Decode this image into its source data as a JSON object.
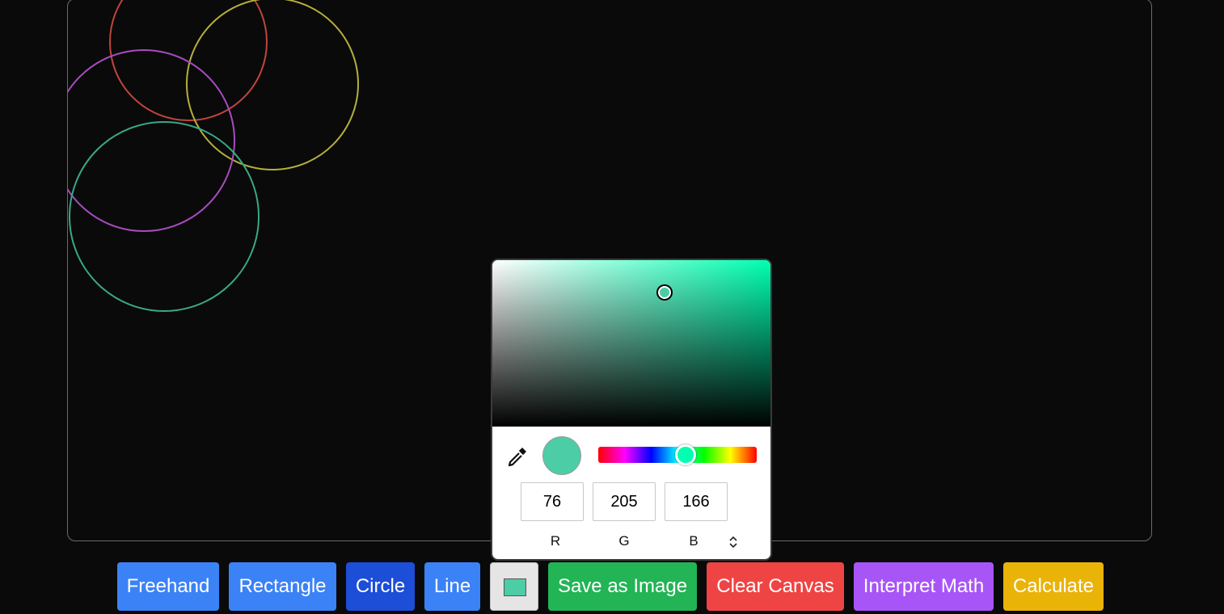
{
  "canvas": {
    "circle_colors": [
      "#c0453c",
      "#b5b139",
      "#a84cc0",
      "#3aa889"
    ]
  },
  "toolbar": {
    "buttons": [
      {
        "label": "Freehand",
        "color": "#3b82f6"
      },
      {
        "label": "Rectangle",
        "color": "#3b82f6"
      },
      {
        "label": "Circle",
        "color": "#1d4ed8"
      },
      {
        "label": "Line",
        "color": "#3b82f6"
      },
      {
        "label": "Save as Image",
        "color": "#22b455"
      },
      {
        "label": "Clear Canvas",
        "color": "#ef4444"
      },
      {
        "label": "Interpret Math",
        "color": "#a855f7"
      },
      {
        "label": "Calculate",
        "color": "#eab308"
      }
    ],
    "selected_color": "#4ccda6"
  },
  "color_picker": {
    "hue_color": "#00ffb0",
    "current_color": "#4ccda6",
    "r": "76",
    "g": "205",
    "b": "166",
    "labels": {
      "r": "R",
      "g": "G",
      "b": "B"
    },
    "icons": {
      "eyedropper": "eyedropper-icon",
      "mode_toggle": "chevron-up-down-icon"
    }
  }
}
